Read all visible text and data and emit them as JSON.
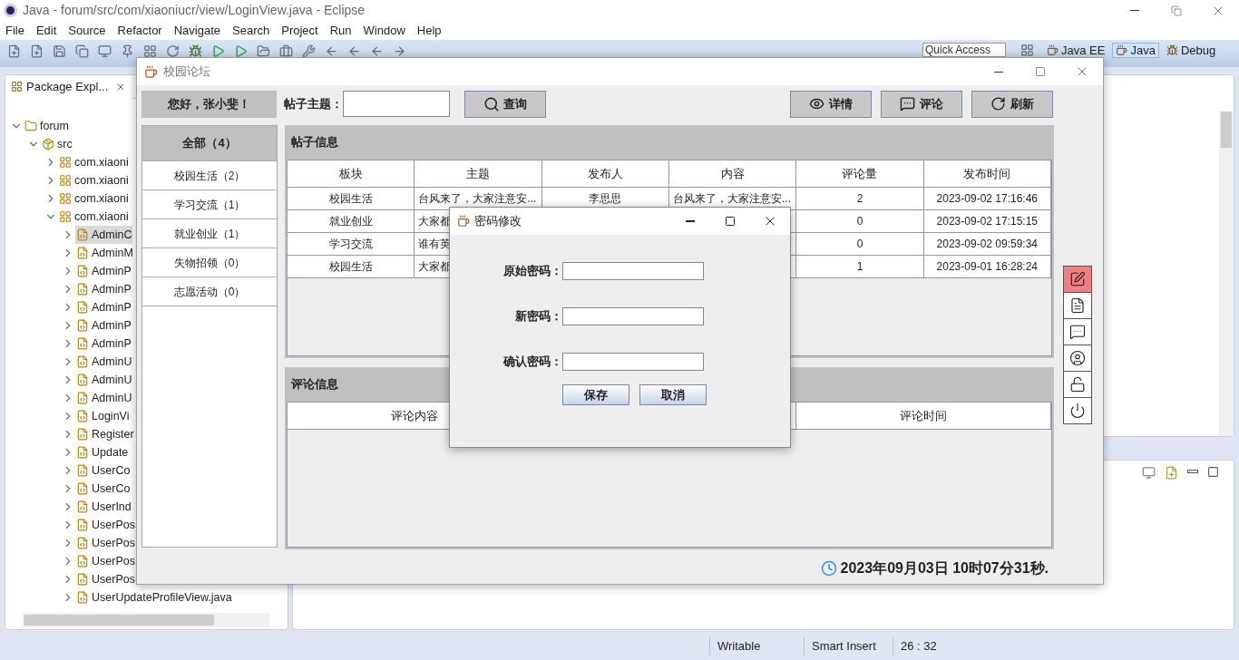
{
  "window": {
    "title": "Java - forum/src/com/xiaoniucr/view/LoginView.java - Eclipse"
  },
  "menu": [
    "File",
    "Edit",
    "Source",
    "Refactor",
    "Navigate",
    "Search",
    "Project",
    "Run",
    "Window",
    "Help"
  ],
  "quick_access": {
    "placeholder": "Quick Access"
  },
  "perspectives": [
    {
      "label": "Java EE",
      "selected": false
    },
    {
      "label": "Java",
      "selected": true
    },
    {
      "label": "Debug",
      "selected": false
    }
  ],
  "package_explorer": {
    "tab": "Package Expl...",
    "tree": [
      {
        "label": "forum",
        "kind": "project",
        "expanded": true,
        "selected": false,
        "children": [
          {
            "label": "src",
            "kind": "folder",
            "expanded": true,
            "selected": false,
            "children": [
              {
                "label": "com.xiaoni",
                "kind": "package",
                "expanded": false,
                "selected": false
              },
              {
                "label": "com.xiaoni",
                "kind": "package",
                "expanded": false,
                "selected": false
              },
              {
                "label": "com.xiaoni",
                "kind": "package",
                "expanded": false,
                "selected": false
              },
              {
                "label": "com.xiaoni",
                "kind": "package",
                "expanded": true,
                "selected": false,
                "children": [
                  {
                    "label": "AdminC",
                    "kind": "file",
                    "expanded": false,
                    "selected": true
                  },
                  {
                    "label": "AdminM",
                    "kind": "file",
                    "expanded": false,
                    "selected": false
                  },
                  {
                    "label": "AdminP",
                    "kind": "file",
                    "expanded": false,
                    "selected": false
                  },
                  {
                    "label": "AdminP",
                    "kind": "file",
                    "expanded": false,
                    "selected": false
                  },
                  {
                    "label": "AdminP",
                    "kind": "file",
                    "expanded": false,
                    "selected": false
                  },
                  {
                    "label": "AdminP",
                    "kind": "file",
                    "expanded": false,
                    "selected": false
                  },
                  {
                    "label": "AdminP",
                    "kind": "file",
                    "expanded": false,
                    "selected": false
                  },
                  {
                    "label": "AdminU",
                    "kind": "file",
                    "expanded": false,
                    "selected": false
                  },
                  {
                    "label": "AdminU",
                    "kind": "file",
                    "expanded": false,
                    "selected": false
                  },
                  {
                    "label": "AdminU",
                    "kind": "file",
                    "expanded": false,
                    "selected": false
                  },
                  {
                    "label": "LoginVi",
                    "kind": "file",
                    "expanded": false,
                    "selected": false
                  },
                  {
                    "label": "Register",
                    "kind": "file",
                    "expanded": false,
                    "selected": false
                  },
                  {
                    "label": "Update",
                    "kind": "file",
                    "expanded": false,
                    "selected": false
                  },
                  {
                    "label": "UserCo",
                    "kind": "file",
                    "expanded": false,
                    "selected": false
                  },
                  {
                    "label": "UserCo",
                    "kind": "file",
                    "expanded": false,
                    "selected": false
                  },
                  {
                    "label": "UserInd",
                    "kind": "file",
                    "expanded": false,
                    "selected": false
                  },
                  {
                    "label": "UserPos",
                    "kind": "file",
                    "expanded": false,
                    "selected": false
                  },
                  {
                    "label": "UserPos",
                    "kind": "file",
                    "expanded": false,
                    "selected": false
                  },
                  {
                    "label": "UserPos",
                    "kind": "file",
                    "expanded": false,
                    "selected": false
                  },
                  {
                    "label": "UserPos",
                    "kind": "file",
                    "expanded": false,
                    "selected": false
                  },
                  {
                    "label": "UserUpdateProfileView.java",
                    "kind": "file",
                    "expanded": false,
                    "selected": false
                  }
                ]
              }
            ]
          }
        ]
      }
    ]
  },
  "status_bar": [
    "Writable",
    "Smart Insert",
    "26 : 32"
  ],
  "app": {
    "title": "校园论坛",
    "greeting": "您好，张小斐！",
    "search_label": "帖子主题：",
    "search_button": {
      "label": "查询",
      "kind": "search"
    },
    "actions": [
      {
        "label": "详情",
        "kind": "view"
      },
      {
        "label": "评论",
        "kind": "comment"
      },
      {
        "label": "刷新",
        "kind": "refresh"
      }
    ],
    "categories": [
      {
        "label": "全部（4）",
        "selected": true
      },
      {
        "label": "校园生活（2）",
        "selected": false
      },
      {
        "label": "学习交流（1）",
        "selected": false
      },
      {
        "label": "就业创业（1）",
        "selected": false
      },
      {
        "label": "失物招领（0）",
        "selected": false
      },
      {
        "label": "志愿活动（0）",
        "selected": false
      }
    ],
    "posts": {
      "title": "帖子信息",
      "columns": [
        "板块",
        "主题",
        "发布人",
        "内容",
        "评论量",
        "发布时间"
      ],
      "rows": [
        [
          "校园生活",
          "台风来了，大家注意安...",
          "李思思",
          "台风来了，大家注意安...",
          "2",
          "2023-09-02 17:16:46"
        ],
        [
          "就业创业",
          "大家都",
          null,
          null,
          "0",
          "2023-09-02 17:15:15"
        ],
        [
          "学习交流",
          "谁有英",
          null,
          null,
          "0",
          "2023-09-02 09:59:34"
        ],
        [
          "校园生活",
          "大家都",
          null,
          null,
          "1",
          "2023-09-01 16:28:24"
        ]
      ]
    },
    "comments": {
      "title": "评论信息",
      "columns": [
        "评论内容",
        null,
        "评论时间"
      ]
    },
    "tools": [
      {
        "kind": "edit",
        "selected": true
      },
      {
        "kind": "document",
        "selected": false
      },
      {
        "kind": "comment",
        "selected": false
      },
      {
        "kind": "user",
        "selected": false
      },
      {
        "kind": "lock",
        "selected": false
      },
      {
        "kind": "power",
        "selected": false
      }
    ],
    "clock": "2023年09月03日 10时07分31秒."
  },
  "dialog": {
    "title": "密码修改",
    "fields": [
      {
        "label": "原始密码："
      },
      {
        "label": "新密码："
      },
      {
        "label": "确认密码："
      }
    ],
    "buttons": [
      "保存",
      "取消"
    ]
  }
}
